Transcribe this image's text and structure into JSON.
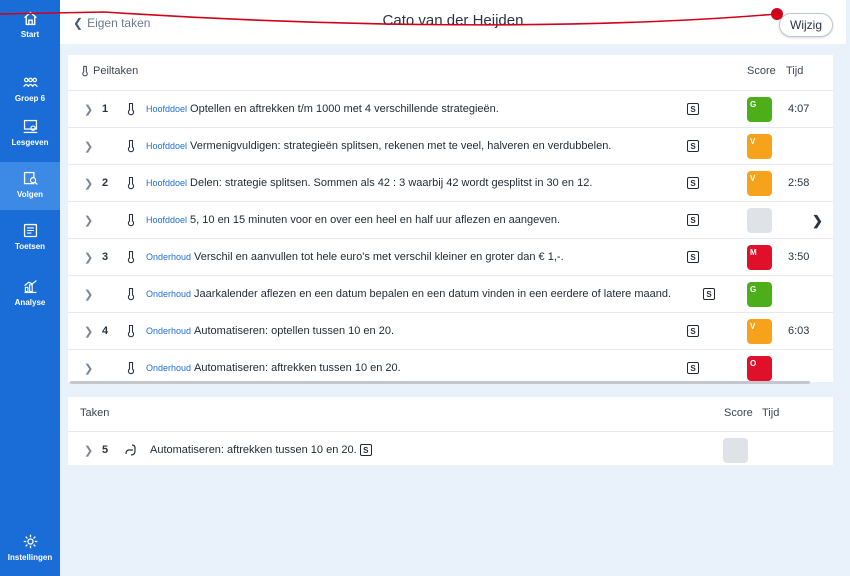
{
  "sidebar": {
    "items": [
      {
        "label": "Start",
        "icon": "home-icon"
      },
      {
        "label": "Groep 6",
        "icon": "group-icon"
      },
      {
        "label": "Lesgeven",
        "icon": "lesson-icon"
      },
      {
        "label": "Volgen",
        "icon": "follow-icon"
      },
      {
        "label": "Toetsen",
        "icon": "tests-icon"
      },
      {
        "label": "Analyse",
        "icon": "analysis-icon"
      },
      {
        "label": "Instellingen",
        "icon": "gear-icon"
      }
    ]
  },
  "header": {
    "back_label": "Eigen taken",
    "title": "Cato van der Heijden",
    "edit_label": "Wijzig"
  },
  "peiltaken": {
    "heading": "Peiltaken",
    "score_label": "Score",
    "time_label": "Tijd",
    "rows": [
      {
        "num": "1",
        "category": "Hoofddoel",
        "text": "Optellen en aftrekken t/m 1000 met 4 verschillende strategieën.",
        "badge": "S",
        "score": "G",
        "time": "4:07"
      },
      {
        "num": "",
        "category": "Hoofddoel",
        "text": "Vermenigvuldigen: strategieën splitsen, rekenen met te veel, halveren en verdubbelen.",
        "badge": "S",
        "score": "V",
        "time": ""
      },
      {
        "num": "2",
        "category": "Hoofddoel",
        "text": "Delen: strategie splitsen. Sommen als 42 : 3 waarbij 42 wordt gesplitst in 30 en 12.",
        "badge": "S",
        "score": "V",
        "time": "2:58"
      },
      {
        "num": "",
        "category": "Hoofddoel",
        "text": "5, 10 en 15 minuten voor en over een heel en half uur aflezen en aangeven.",
        "badge": "S",
        "score": "",
        "time": ""
      },
      {
        "num": "3",
        "category": "Onderhoud",
        "text": "Verschil en aanvullen tot hele euro's met verschil kleiner en groter dan € 1,-.",
        "badge": "S",
        "score": "M",
        "time": "3:50"
      },
      {
        "num": "",
        "category": "Onderhoud",
        "text": "Jaarkalender aflezen en een datum bepalen en een datum vinden in een eerdere of latere maand.",
        "badge": "S",
        "score": "G",
        "time": ""
      },
      {
        "num": "4",
        "category": "Onderhoud",
        "text": "Automatiseren: optellen tussen 10 en 20.",
        "badge": "S",
        "score": "V",
        "time": "6:03"
      },
      {
        "num": "",
        "category": "Onderhoud",
        "text": "Automatiseren: aftrekken tussen 10 en 20.",
        "badge": "S",
        "score": "O",
        "time": ""
      }
    ]
  },
  "taken": {
    "heading": "Taken",
    "score_label": "Score",
    "time_label": "Tijd",
    "rows": [
      {
        "num": "5",
        "text": "Automatiseren: aftrekken tussen 10 en 20.",
        "badge": "S",
        "score": "",
        "time": ""
      }
    ]
  },
  "colors": {
    "sidebar": "#1a6dd6",
    "score_G": "#4caf1a",
    "score_V": "#f7a21b",
    "score_M": "#e0102a",
    "score_O": "#e0102a",
    "score_empty": "#dfe3e8",
    "annotation": "#d0021b"
  }
}
